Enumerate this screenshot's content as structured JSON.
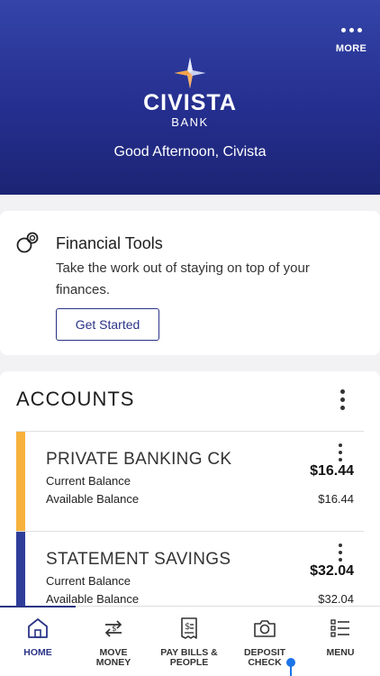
{
  "header": {
    "more_label": "MORE",
    "brand_name": "CIVISTA",
    "brand_sub": "BANK",
    "greeting": "Good Afternoon, Civista",
    "colors": {
      "gradient_top": "#3444a8",
      "gradient_bottom": "#1c2474",
      "logo_orange": "#f4a24a"
    }
  },
  "financial_tools": {
    "icon": "coins-icon",
    "title": "Financial Tools",
    "description": "Take the work out of staying on top of your finances.",
    "button_label": "Get Started"
  },
  "accounts": {
    "title": "ACCOUNTS",
    "items": [
      {
        "name": "PRIVATE BANKING CK",
        "current_label": "Current Balance",
        "current_amount": "$16.44",
        "available_label": "Available Balance",
        "available_amount": "$16.44",
        "color": "#f7b13c"
      },
      {
        "name": "STATEMENT SAVINGS",
        "current_label": "Current Balance",
        "current_amount": "$32.04",
        "available_label": "Available Balance",
        "available_amount": "$32.04",
        "color": "#2f3d9a"
      }
    ]
  },
  "nav": {
    "items": [
      {
        "label_1": "HOME",
        "label_2": "",
        "icon": "home-icon",
        "active": true
      },
      {
        "label_1": "MOVE",
        "label_2": "MONEY",
        "icon": "transfer-arrows-icon",
        "active": false
      },
      {
        "label_1": "PAY BILLS &",
        "label_2": "PEOPLE",
        "icon": "bill-icon",
        "active": false
      },
      {
        "label_1": "DEPOSIT",
        "label_2": "CHECK",
        "icon": "camera-icon",
        "active": false
      },
      {
        "label_1": "MENU",
        "label_2": "",
        "icon": "menu-list-icon",
        "active": false
      }
    ],
    "accent": "#2a3487"
  }
}
